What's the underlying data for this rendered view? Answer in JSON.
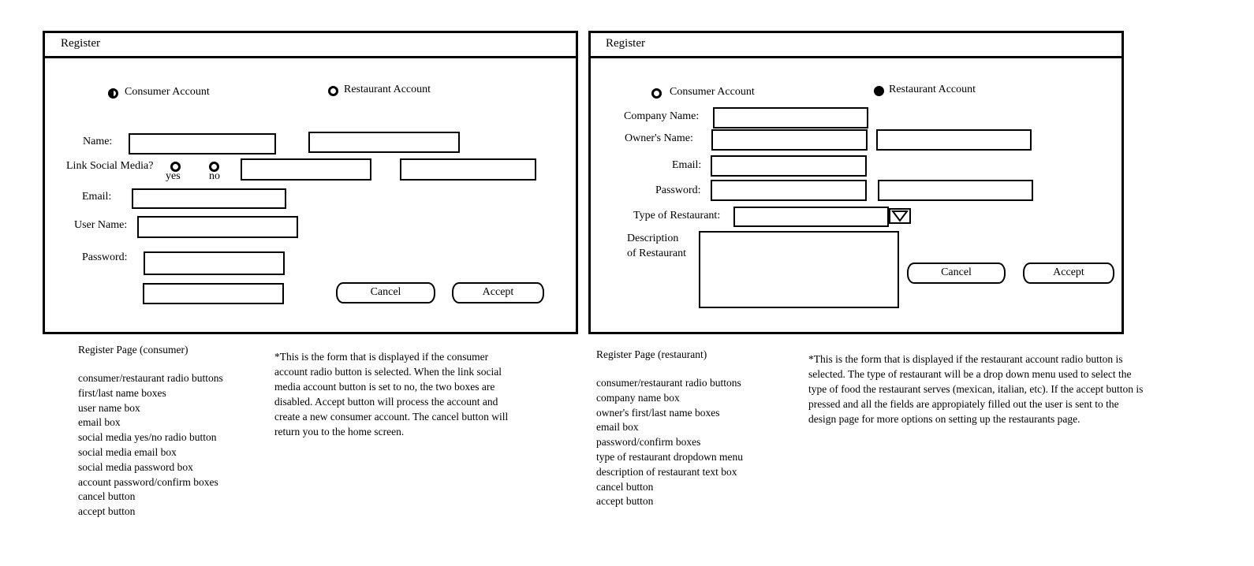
{
  "consumer_form": {
    "title": "Register",
    "radio_consumer": "Consumer Account",
    "radio_restaurant": "Restaurant Account",
    "name_label": "Name:",
    "link_social_label": "Link Social Media?",
    "yes_label": "yes",
    "no_label": "no",
    "email_label": "Email:",
    "username_label": "User Name:",
    "password_label": "Password:",
    "cancel_label": "Cancel",
    "accept_label": "Accept",
    "selected_account": "consumer"
  },
  "restaurant_form": {
    "title": "Register",
    "radio_consumer": "Consumer Account",
    "radio_restaurant": "Restaurant Account",
    "company_label": "Company Name:",
    "owner_label": "Owner's Name:",
    "email_label": "Email:",
    "password_label": "Password:",
    "type_label": "Type of Restaurant:",
    "desc_label_line1": "Description",
    "desc_label_line2": "of Restaurant",
    "cancel_label": "Cancel",
    "accept_label": "Accept",
    "selected_account": "restaurant"
  },
  "consumer_notes": {
    "heading": "Register Page (consumer)",
    "items": [
      "consumer/restaurant radio buttons",
      "first/last name boxes",
      "user name box",
      "email box",
      "social media yes/no radio button",
      "social media email box",
      "social media password box",
      "account password/confirm boxes",
      "cancel button",
      "accept button"
    ],
    "description": "*This is the form that is displayed if the consumer account radio button is selected. When the link social media account button is set to no, the two boxes are disabled. Accept button will process the account and create a new consumer account. The cancel button will return you to the home screen."
  },
  "restaurant_notes": {
    "heading": "Register Page (restaurant)",
    "items": [
      "consumer/restaurant radio buttons",
      "company name box",
      "owner's first/last name boxes",
      "email box",
      "password/confirm boxes",
      "type of restaurant dropdown menu",
      "description of restaurant text box",
      "cancel button",
      "accept button"
    ],
    "description": "*This is the form that is displayed if the restaurant account radio button is selected. The type of restaurant will be a drop down menu used to select the type of food the restaurant serves (mexican, italian, etc). If the accept button is pressed and all the fields are appropiately filled out the user is sent to the design page for more options on setting up the restaurants page."
  },
  "icons": {
    "dropdown": "triangle-down-icon"
  }
}
